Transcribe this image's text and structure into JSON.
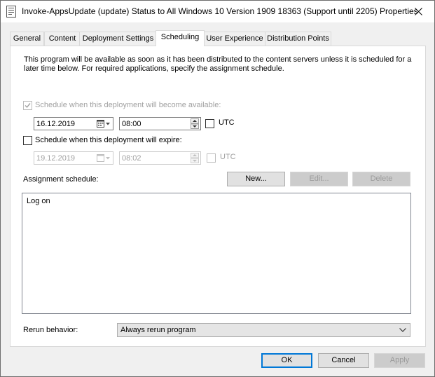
{
  "window": {
    "title": "Invoke-AppsUpdate (update) Status to All Windows 10 Version 1909 18363 (Support until 2205) Properties"
  },
  "tabs": [
    {
      "label": "General"
    },
    {
      "label": "Content"
    },
    {
      "label": "Deployment Settings"
    },
    {
      "label": "Scheduling",
      "selected": true
    },
    {
      "label": "User Experience"
    },
    {
      "label": "Distribution Points"
    }
  ],
  "scheduling": {
    "intro": "This program will be available as soon as it has been distributed to the content servers unless it is scheduled for a later time below. For required applications, specify the assignment schedule.",
    "available": {
      "label": "Schedule when this deployment will become available:",
      "checked": true,
      "date": "16.12.2019",
      "time": "08:00",
      "utc_label": "UTC"
    },
    "expire": {
      "label": "Schedule when this deployment will expire:",
      "checked": false,
      "date": "19.12.2019",
      "time": "08:02",
      "utc_label": "UTC"
    },
    "assignment": {
      "label": "Assignment schedule:",
      "new_label": "New...",
      "edit_label": "Edit...",
      "delete_label": "Delete",
      "items": [
        "Log on"
      ]
    },
    "rerun": {
      "label": "Rerun behavior:",
      "value": "Always rerun program"
    }
  },
  "footer": {
    "ok_label": "OK",
    "cancel_label": "Cancel",
    "apply_label": "Apply"
  },
  "colors": {
    "accent": "#0078d7",
    "dialog_bg": "#f0f0f0",
    "disabled_text": "#a0a0a0"
  }
}
